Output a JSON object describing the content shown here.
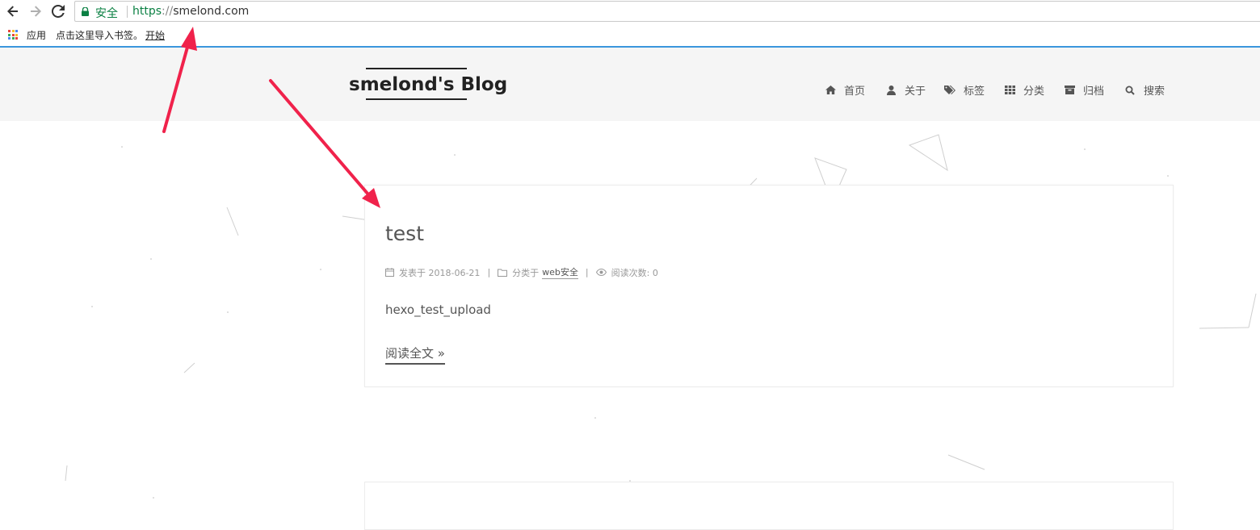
{
  "browser": {
    "secure_label": "安全",
    "url_scheme": "https",
    "url_slashes": "://",
    "url_host": "smelond.com",
    "bookmarks": {
      "apps_label": "应用",
      "import_text": "点击这里导入书签。",
      "start_link": "开始"
    }
  },
  "site": {
    "brand": "smelond's Blog",
    "menu": [
      {
        "label": "首页",
        "icon": "home-icon"
      },
      {
        "label": "关于",
        "icon": "user-icon"
      },
      {
        "label": "标签",
        "icon": "tags-icon"
      },
      {
        "label": "分类",
        "icon": "th-icon"
      },
      {
        "label": "归档",
        "icon": "archive-icon"
      },
      {
        "label": "搜索",
        "icon": "search-icon"
      }
    ]
  },
  "post": {
    "title": "test",
    "published_label": "发表于 2018-06-21",
    "category_label": "分类于",
    "category_link": "web安全",
    "views_label": "阅读次数: 0",
    "excerpt": "hexo_test_upload",
    "read_more": "阅读全文 »"
  },
  "colors": {
    "secure_green": "#0b8043",
    "header_bg": "#f5f5f5",
    "arrow_red": "#f0224b",
    "top_line_blue": "#3a96dd"
  }
}
